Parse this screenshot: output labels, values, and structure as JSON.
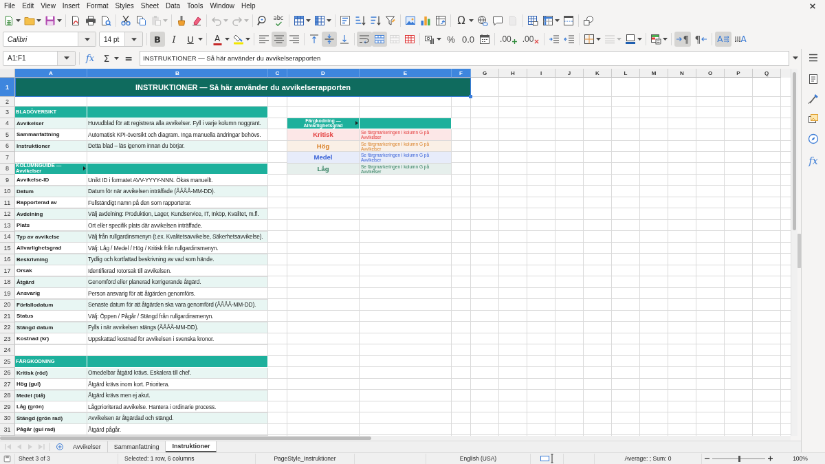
{
  "menu_bar": {
    "items": [
      "File",
      "Edit",
      "View",
      "Insert",
      "Format",
      "Styles",
      "Sheet",
      "Data",
      "Tools",
      "Window",
      "Help"
    ]
  },
  "standard_toolbar": {
    "paste": {
      "disabled": true
    },
    "undo": {
      "disabled": true
    },
    "redo": {
      "disabled": true
    },
    "spelling": {
      "symbol": "abc"
    },
    "special_character": {
      "symbol": "Ω"
    },
    "header_footer": {
      "disabled": true
    }
  },
  "formatting_toolbar": {
    "font_name": "Calibri",
    "font_size": "14 pt",
    "bold": {
      "symbol": "B",
      "pressed": true
    },
    "italic": {
      "symbol": "I",
      "pressed": false
    },
    "underline": {
      "symbol": "U",
      "pressed": false
    },
    "font_color": {
      "symbol": "A"
    },
    "align_left": {
      "pressed": false
    },
    "align_center": {
      "pressed": true
    },
    "align_right": {
      "pressed": false
    },
    "align_top": {
      "pressed": false
    },
    "align_middle": {
      "pressed": true
    },
    "align_bottom": {
      "pressed": false
    },
    "wrap_text": {
      "pressed": true
    },
    "merge_and_center": {
      "pressed": true
    },
    "merge_cells": {
      "disabled": true
    },
    "percent": {
      "symbol": "%"
    },
    "number": {
      "symbol": "0.0"
    },
    "add_decimal": {
      "symbol": ".00"
    },
    "delete_decimal": {
      "symbol": ".00"
    },
    "border_style": {
      "disabled": true
    },
    "left_to_right": {
      "symbol": "¶",
      "pressed": true
    },
    "right_to_left": {
      "symbol": "¶",
      "pressed": false
    },
    "text_horizontal": {
      "symbol": "A",
      "pressed": true
    },
    "text_vertical": {
      "symbol": "A",
      "pressed": false
    }
  },
  "formula_bar": {
    "name_box": "A1:F1",
    "function_symbol": "fx",
    "sum_symbol": "Σ",
    "equals_symbol": "=",
    "content": "INSTRUKTIONER — Så här använder du avvikelserapporten"
  },
  "sheet": {
    "columns": [
      {
        "label": "A",
        "selected": true
      },
      {
        "label": "B",
        "selected": true
      },
      {
        "label": "C",
        "selected": true
      },
      {
        "label": "D",
        "selected": true
      },
      {
        "label": "E",
        "selected": true
      },
      {
        "label": "F",
        "selected": true
      },
      {
        "label": "G",
        "selected": false
      },
      {
        "label": "H",
        "selected": false
      },
      {
        "label": "I",
        "selected": false
      },
      {
        "label": "J",
        "selected": false
      },
      {
        "label": "K",
        "selected": false
      },
      {
        "label": "L",
        "selected": false
      },
      {
        "label": "M",
        "selected": false
      },
      {
        "label": "N",
        "selected": false
      },
      {
        "label": "O",
        "selected": false
      },
      {
        "label": "P",
        "selected": false
      },
      {
        "label": "Q",
        "selected": false
      }
    ],
    "rows": [
      {
        "number": "1",
        "selected": true
      },
      {
        "number": "2",
        "selected": false
      },
      {
        "number": "3",
        "selected": false
      },
      {
        "number": "4",
        "selected": false
      },
      {
        "number": "5",
        "selected": false
      },
      {
        "number": "6",
        "selected": false
      },
      {
        "number": "7",
        "selected": false
      },
      {
        "number": "8",
        "selected": false
      },
      {
        "number": "9",
        "selected": false
      },
      {
        "number": "10",
        "selected": false
      },
      {
        "number": "11",
        "selected": false
      },
      {
        "number": "12",
        "selected": false
      },
      {
        "number": "13",
        "selected": false
      },
      {
        "number": "14",
        "selected": false
      },
      {
        "number": "15",
        "selected": false
      },
      {
        "number": "16",
        "selected": false
      },
      {
        "number": "17",
        "selected": false
      },
      {
        "number": "18",
        "selected": false
      },
      {
        "number": "19",
        "selected": false
      },
      {
        "number": "20",
        "selected": false
      },
      {
        "number": "21",
        "selected": false
      },
      {
        "number": "22",
        "selected": false
      },
      {
        "number": "23",
        "selected": false
      },
      {
        "number": "24",
        "selected": false
      },
      {
        "number": "25",
        "selected": false
      },
      {
        "number": "26",
        "selected": false
      },
      {
        "number": "27",
        "selected": false
      },
      {
        "number": "28",
        "selected": false
      },
      {
        "number": "29",
        "selected": false
      },
      {
        "number": "30",
        "selected": false
      },
      {
        "number": "31",
        "selected": false
      }
    ],
    "title": "INSTRUKTIONER — Så här använder du avvikelserapporten",
    "sections": [
      {
        "heading": "BLADÖVERSIKT",
        "overflow": false,
        "entries": [
          {
            "label": "Avvikelser",
            "description": "Huvudblad för att registrera alla avvikelser. Fyll i varje kolumn noggrant."
          },
          {
            "label": "Sammanfattning",
            "description": "Automatisk KPI-översikt och diagram. Inga manuella ändringar behövs."
          },
          {
            "label": "Instruktioner",
            "description": "Detta blad – läs igenom innan du börjar."
          }
        ]
      },
      {
        "heading": "KOLUMNGUIDE — Avvikelser",
        "overflow": true,
        "entries": [
          {
            "label": "Avvikelse-ID",
            "description": "Unikt ID i formatet AVV-YYYY-NNN. Ökas manuellt."
          },
          {
            "label": "Datum",
            "description": "Datum för när avvikelsen inträffade (ÅÅÅÅ-MM-DD)."
          },
          {
            "label": "Rapporterad av",
            "description": "Fullständigt namn på den som rapporterar."
          },
          {
            "label": "Avdelning",
            "description": "Välj avdelning: Produktion, Lager, Kundservice, IT, Inköp, Kvalitet, m.fl."
          },
          {
            "label": "Plats",
            "description": "Ort eller specifik plats där avvikelsen inträffade."
          },
          {
            "label": "Typ av avvikelse",
            "description": "Välj från rullgardinsmenyn (t.ex. Kvalitetsavvikelse, Säkerhetsavvikelse)."
          },
          {
            "label": "Allvarlighetsgrad",
            "description": "Välj: Låg / Medel / Hög / Kritisk från rullgardinsmenyn."
          },
          {
            "label": "Beskrivning",
            "description": "Tydlig och kortfattad beskrivning av vad som hände."
          },
          {
            "label": "Orsak",
            "description": "Identifierad rotorsak till avvikelsen."
          },
          {
            "label": "Åtgärd",
            "description": "Genomförd eller planerad korrigerande åtgärd."
          },
          {
            "label": "Ansvarig",
            "description": "Person ansvarig för att åtgärden genomförs."
          },
          {
            "label": "Förfallodatum",
            "description": "Senaste datum för att åtgärden ska vara genomförd (ÅÅÅÅ-MM-DD)."
          },
          {
            "label": "Status",
            "description": "Välj: Öppen / Pågår / Stängd från rullgardinsmenyn."
          },
          {
            "label": "Stängd datum",
            "description": "Fylls i när avvikelsen stängs (ÅÅÅÅ-MM-DD)."
          },
          {
            "label": "Kostnad (kr)",
            "description": "Uppskattad kostnad för avvikelsen i svenska kronor."
          }
        ]
      },
      {
        "heading": "FÄRGKODNING",
        "overflow": false,
        "entries": [
          {
            "label": "Kritisk (röd)",
            "description": "Omedelbar åtgärd krävs. Eskalera till chef."
          },
          {
            "label": "Hög (gul)",
            "description": "Åtgärd krävs inom kort. Prioritera."
          },
          {
            "label": "Medel (blå)",
            "description": "Åtgärd krävs men ej akut."
          },
          {
            "label": "Låg (grön)",
            "description": "Lågprioriterad avvikelse. Hantera i ordinarie process."
          },
          {
            "label": "Stängd (grön rad)",
            "description": "Avvikelsen är åtgärdad och stängd."
          },
          {
            "label": "Pågår (gul rad)",
            "description": "Åtgärd pågår."
          }
        ]
      }
    ],
    "color_legend": {
      "heading": "Färgkodning — Allvarlighetsgrad",
      "overflow": true,
      "items": [
        {
          "label": "Kritisk",
          "note": "Se färgmarkeringen i kolumn G på Avvikelser",
          "color": "#e23b3b"
        },
        {
          "label": "Hög",
          "note": "Se färgmarkeringen i kolumn G på Avvikelser",
          "color": "#d9822b"
        },
        {
          "label": "Medel",
          "note": "Se färgmarkeringen i kolumn G på Avvikelser",
          "color": "#3b63d6"
        },
        {
          "label": "Låg",
          "note": "Se färgmarkeringen i kolumn G på Avvikelser",
          "color": "#2f7d5d"
        }
      ]
    }
  },
  "tab_navigation": {
    "disabled": true
  },
  "sheet_tabs": [
    {
      "label": "Avvikelser",
      "selected": false
    },
    {
      "label": "Sammanfattning",
      "selected": false
    },
    {
      "label": "Instruktioner",
      "selected": true
    }
  ],
  "sidebar": {
    "function_symbol": "fx"
  },
  "status_bar": {
    "sheet": "Sheet 3 of 3",
    "selection": "Selected: 1 row, 6 columns",
    "page_style": "PageStyle_Instruktioner",
    "language": "English (USA)",
    "summary": "Average: ; Sum: 0",
    "zoom": {
      "level": 0.5,
      "reading": "100%"
    }
  }
}
